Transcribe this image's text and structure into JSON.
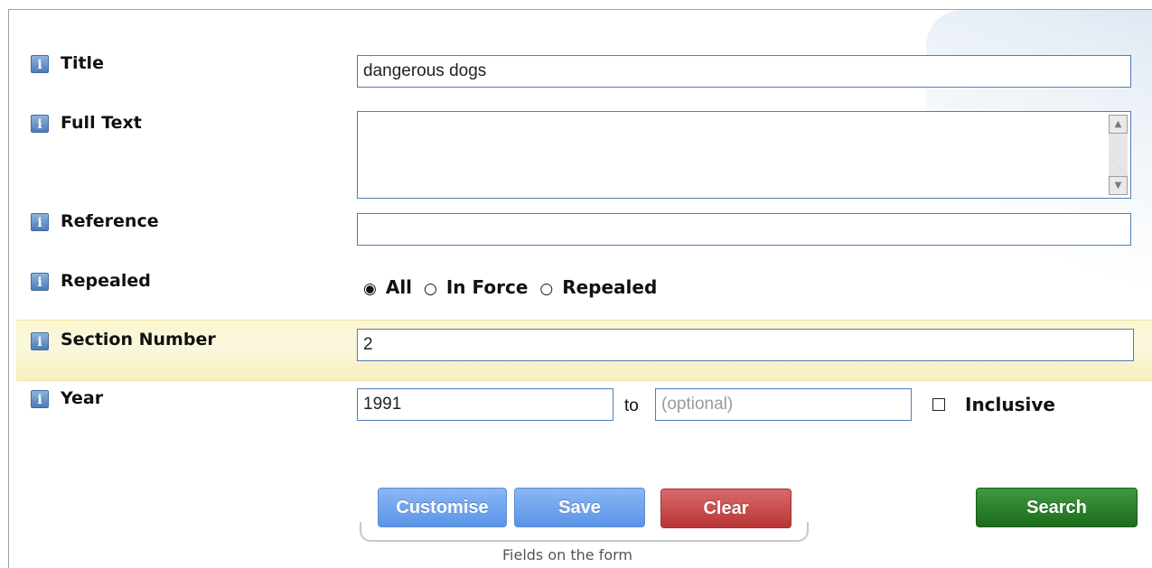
{
  "form": {
    "title": {
      "label": "Title",
      "value": "dangerous dogs"
    },
    "full_text": {
      "label": "Full Text",
      "value": ""
    },
    "reference": {
      "label": "Reference",
      "value": ""
    },
    "repealed": {
      "label": "Repealed",
      "options": [
        "All",
        "In Force",
        "Repealed"
      ],
      "selected": "All"
    },
    "section_number": {
      "label": "Section Number",
      "value": "2"
    },
    "year": {
      "label": "Year",
      "from_value": "1991",
      "to_label": "to",
      "to_placeholder": "(optional)",
      "inclusive_label": "Inclusive",
      "inclusive_checked": false
    }
  },
  "info_icon_glyph": "i",
  "buttons": {
    "customise": "Customise",
    "save": "Save",
    "clear": "Clear",
    "search": "Search"
  },
  "fields_caption": "Fields on the form",
  "colors": {
    "info_icon": "#4c7bb8",
    "input_border": "#4f7db8",
    "highlight_row": "#fbf6cf",
    "button_blue": "#6ea2ee",
    "button_red": "#c04545",
    "button_green": "#26792a"
  }
}
